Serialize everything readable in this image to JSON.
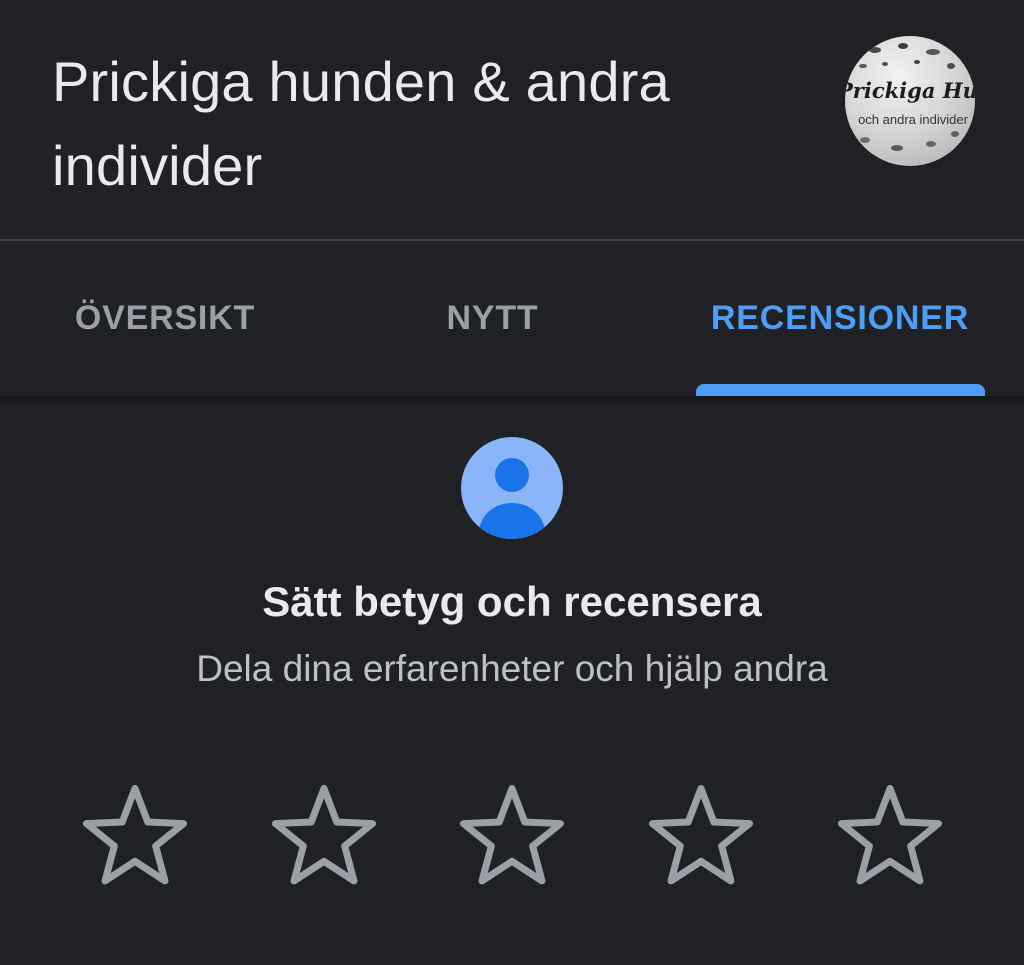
{
  "header": {
    "title": "Prickiga hunden & andra individer",
    "logo": {
      "name_text": "Prickiga Hund",
      "sub_text": "och andra individer"
    }
  },
  "tabs": [
    {
      "label": "ÖVERSIKT",
      "active": false
    },
    {
      "label": "NYTT",
      "active": false
    },
    {
      "label": "RECENSIONER",
      "active": true
    }
  ],
  "review_prompt": {
    "avatar_icon": "person-icon",
    "title": "Sätt betyg och recensera",
    "subtitle": "Dela dina erfarenheter och hjälp andra",
    "star_icon": "star-outline-icon",
    "star_count": 5,
    "selected_rating": 0
  },
  "colors": {
    "background": "#202124",
    "accent": "#4c9ef6",
    "tab_inactive": "#9aa0a6",
    "star_outline": "#9aa0a6",
    "avatar_bg": "#8ab4f8",
    "avatar_fg": "#1a73e8"
  }
}
